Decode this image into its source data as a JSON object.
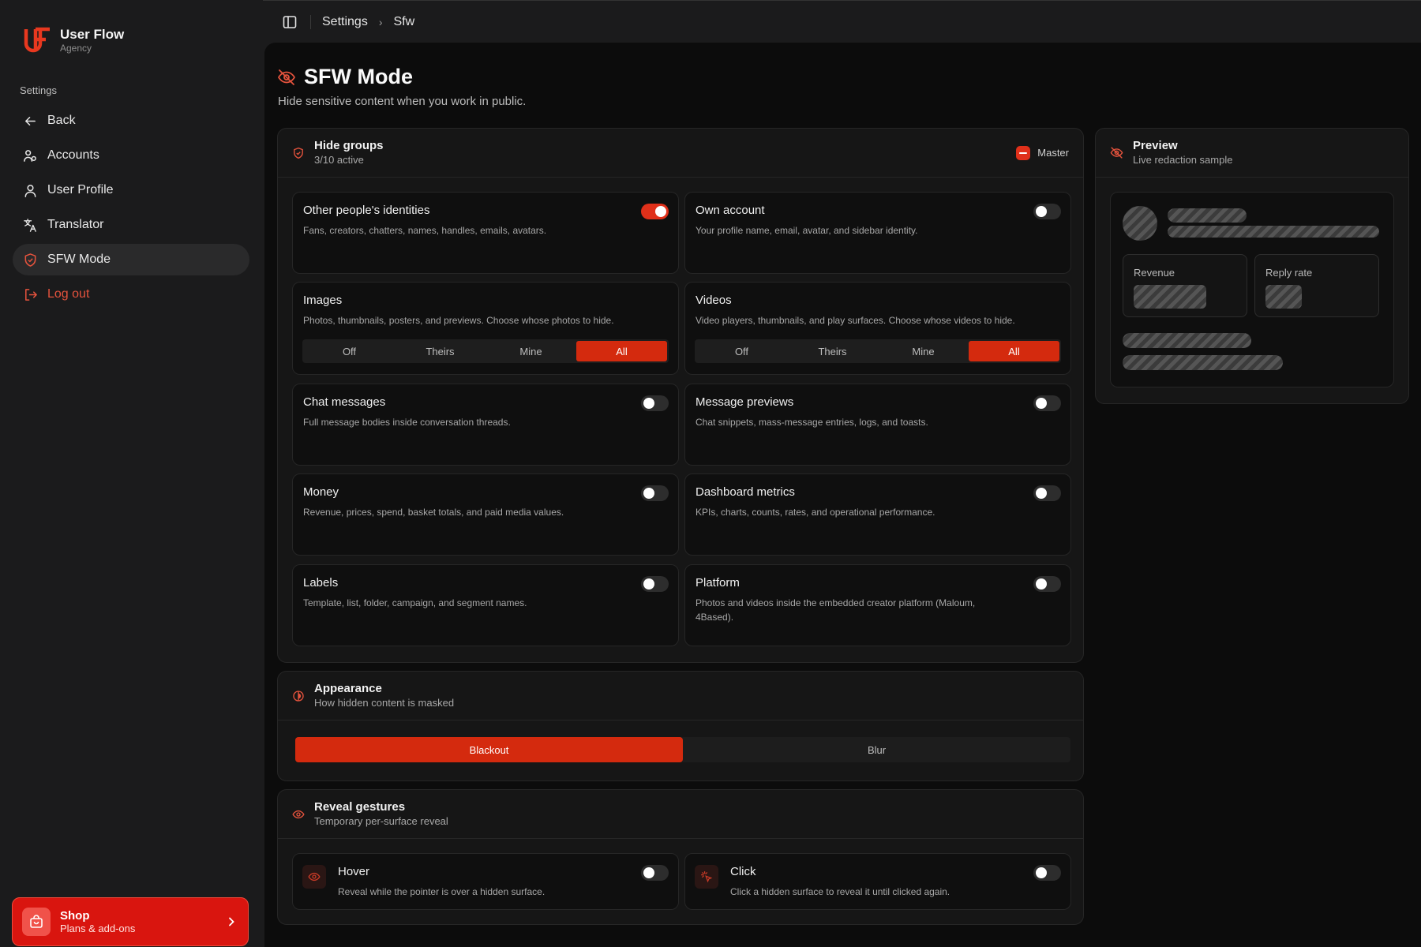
{
  "brand": {
    "title": "User Flow",
    "subtitle": "Agency"
  },
  "sidebar": {
    "section": "Settings",
    "items": [
      {
        "label": "Back",
        "icon": "arrow-left-icon"
      },
      {
        "label": "Accounts",
        "icon": "users-icon"
      },
      {
        "label": "User Profile",
        "icon": "user-icon"
      },
      {
        "label": "Translator",
        "icon": "translate-icon"
      },
      {
        "label": "SFW Mode",
        "icon": "shield-icon",
        "active": true
      },
      {
        "label": "Log out",
        "icon": "logout-icon"
      }
    ],
    "shop": {
      "title": "Shop",
      "subtitle": "Plans & add-ons"
    }
  },
  "breadcrumb": {
    "items": [
      "Settings",
      "Sfw"
    ]
  },
  "page": {
    "title": "SFW Mode",
    "subtitle": "Hide sensitive content when you work in public."
  },
  "hide_groups": {
    "title": "Hide groups",
    "subtitle": "3/10 active",
    "master_label": "Master",
    "tiles": [
      {
        "title": "Other people's identities",
        "desc": "Fans, creators, chatters, names, handles, emails, avatars.",
        "on": true
      },
      {
        "title": "Own account",
        "desc": "Your profile name, email, avatar, and sidebar identity.",
        "on": false
      },
      {
        "title": "Images",
        "desc": "Photos, thumbnails, posters, and previews. Choose whose photos to hide.",
        "options": [
          "Off",
          "Theirs",
          "Mine",
          "All"
        ],
        "selected": "All"
      },
      {
        "title": "Videos",
        "desc": "Video players, thumbnails, and play surfaces. Choose whose videos to hide.",
        "options": [
          "Off",
          "Theirs",
          "Mine",
          "All"
        ],
        "selected": "All"
      },
      {
        "title": "Chat messages",
        "desc": "Full message bodies inside conversation threads.",
        "on": false
      },
      {
        "title": "Message previews",
        "desc": "Chat snippets, mass-message entries, logs, and toasts.",
        "on": false
      },
      {
        "title": "Money",
        "desc": "Revenue, prices, spend, basket totals, and paid media values.",
        "on": false
      },
      {
        "title": "Dashboard metrics",
        "desc": "KPIs, charts, counts, rates, and operational performance.",
        "on": false
      },
      {
        "title": "Labels",
        "desc": "Template, list, folder, campaign, and segment names.",
        "on": false
      },
      {
        "title": "Platform",
        "desc": "Photos and videos inside the embedded creator platform (Maloum, 4Based).",
        "on": false
      }
    ]
  },
  "appearance": {
    "title": "Appearance",
    "subtitle": "How hidden content is masked",
    "options": [
      "Blackout",
      "Blur"
    ],
    "selected": "Blackout"
  },
  "reveal": {
    "title": "Reveal gestures",
    "subtitle": "Temporary per-surface reveal",
    "items": [
      {
        "title": "Hover",
        "desc": "Reveal while the pointer is over a hidden surface.",
        "on": false,
        "icon": "eye-icon"
      },
      {
        "title": "Click",
        "desc": "Click a hidden surface to reveal it until clicked again.",
        "on": false,
        "icon": "pointer-click-icon"
      }
    ]
  },
  "preview": {
    "title": "Preview",
    "subtitle": "Live redaction sample",
    "metrics": [
      "Revenue",
      "Reply rate"
    ]
  },
  "colors": {
    "accent": "#e0301a",
    "background": "#0c0c0c",
    "sidebar": "#1b1b1c"
  }
}
